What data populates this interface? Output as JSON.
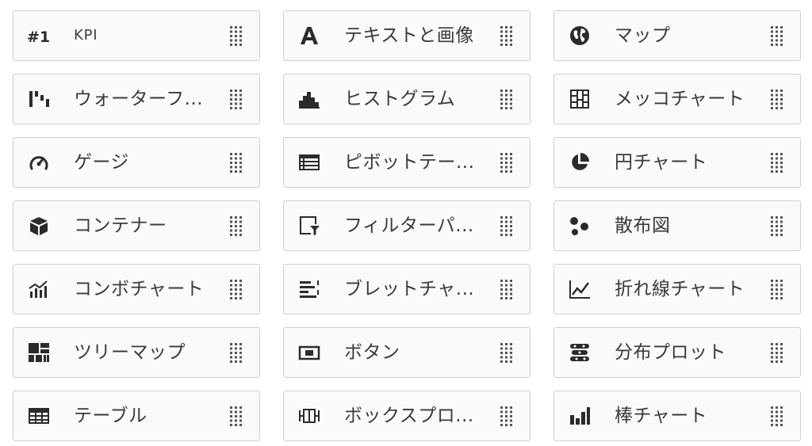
{
  "items": [
    {
      "label": "KPI",
      "icon": "kpi-icon"
    },
    {
      "label": "テキストと画像",
      "icon": "text-image-icon"
    },
    {
      "label": "マップ",
      "icon": "map-globe-icon"
    },
    {
      "label": "ウォーターフ...",
      "icon": "waterfall-chart-icon"
    },
    {
      "label": "ヒストグラム",
      "icon": "histogram-icon"
    },
    {
      "label": "メッコチャート",
      "icon": "mekko-chart-icon"
    },
    {
      "label": "ゲージ",
      "icon": "gauge-icon"
    },
    {
      "label": "ピボットテー...",
      "icon": "pivot-table-icon"
    },
    {
      "label": "円チャート",
      "icon": "pie-chart-icon"
    },
    {
      "label": "コンテナー",
      "icon": "container-box-icon"
    },
    {
      "label": "フィルターパ...",
      "icon": "filter-pane-icon"
    },
    {
      "label": "散布図",
      "icon": "scatter-plot-icon"
    },
    {
      "label": "コンボチャート",
      "icon": "combo-chart-icon"
    },
    {
      "label": "ブレットチャ...",
      "icon": "bullet-chart-icon"
    },
    {
      "label": "折れ線チャート",
      "icon": "line-chart-icon"
    },
    {
      "label": "ツリーマップ",
      "icon": "treemap-icon"
    },
    {
      "label": "ボタン",
      "icon": "button-icon"
    },
    {
      "label": "分布プロット",
      "icon": "distribution-plot-icon"
    },
    {
      "label": "テーブル",
      "icon": "table-icon"
    },
    {
      "label": "ボックスプロ...",
      "icon": "box-plot-icon"
    },
    {
      "label": "棒チャート",
      "icon": "bar-chart-icon"
    }
  ],
  "drag_handle_icon": "drag-handle-icon",
  "colors": {
    "icon": "#2b2b2b",
    "text": "#3a3a3a",
    "card_border": "#cfcfcf",
    "card_bg": "#fafafa"
  }
}
